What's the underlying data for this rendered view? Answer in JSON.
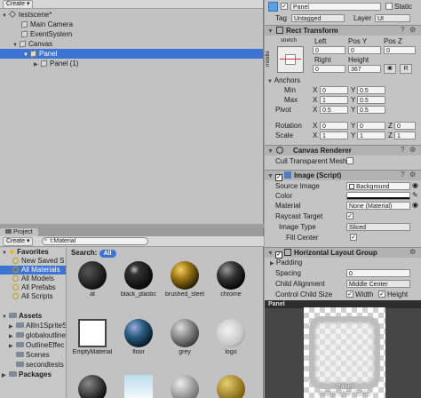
{
  "hierarchy": {
    "create": "Create ▾",
    "items": [
      "testscene*",
      "Main Camera",
      "EventSystem",
      "Canvas",
      "Panel",
      "Panel (1)"
    ]
  },
  "project": {
    "tab": "Project",
    "create": "Create ▾",
    "search_value": "t:Material",
    "search_label": "Search:",
    "search_scope": "All",
    "favorites": [
      "Favorites",
      "New Saved S",
      "All Materials",
      "All Models",
      "All Prefabs",
      "All Scripts"
    ],
    "assets": [
      "Assets",
      "AllIn1SpriteS",
      "globaloutline",
      "OutlineEffec",
      "Scenes",
      "secondtests",
      "Packages"
    ],
    "items": [
      "at",
      "black_plastic",
      "brushed_steel",
      "chrome",
      "EmptyMaterial",
      "floor",
      "grey",
      "logo"
    ]
  },
  "inspector": {
    "name_value": "Panel",
    "static_label": "Static",
    "tag_label": "Tag",
    "tag_value": "Untagged",
    "layer_label": "Layer",
    "layer_value": "UI",
    "rect": {
      "title": "Rect Transform",
      "anchor_top": "stretch",
      "anchor_side": "middle",
      "left_label": "Left",
      "posy_label": "Pos Y",
      "posz_label": "Pos Z",
      "left": "0",
      "posy": "0",
      "posz": "0",
      "right_label": "Right",
      "height_label": "Height",
      "right": "0",
      "height": "367",
      "anchors_label": "Anchors",
      "min_label": "Min",
      "min_x": "0",
      "min_y": "0.5",
      "max_label": "Max",
      "max_x": "1",
      "max_y": "0.5",
      "pivot_label": "Pivot",
      "pivot_x": "0.5",
      "pivot_y": "0.5",
      "rotation_label": "Rotation",
      "rot_x": "0",
      "rot_y": "0",
      "rot_z": "0",
      "scale_label": "Scale",
      "sc_x": "1",
      "sc_y": "1",
      "sc_z": "1",
      "x": "X",
      "y": "Y",
      "z": "Z",
      "r": "R"
    },
    "canvas_renderer": {
      "title": "Canvas Renderer",
      "cull_label": "Cull Transparent Mesh"
    },
    "image": {
      "title": "Image (Script)",
      "source_label": "Source Image",
      "source_value": "Background",
      "color_label": "Color",
      "material_label": "Material",
      "material_value": "None (Material)",
      "raycast_label": "Raycast Target",
      "type_label": "Image Type",
      "type_value": "Sliced",
      "fill_label": "Fill Center"
    },
    "hlg": {
      "title": "Horizontal Layout Group",
      "padding_label": "Padding",
      "spacing_label": "Spacing",
      "spacing_value": "0",
      "align_label": "Child Alignment",
      "align_value": "Middle Center",
      "control_label": "Control Child Size",
      "width_label": "Width",
      "height_label": "Height"
    }
  },
  "preview": {
    "title": "Panel",
    "caption1": "Panel",
    "caption2": "Image Size: 32x32"
  }
}
